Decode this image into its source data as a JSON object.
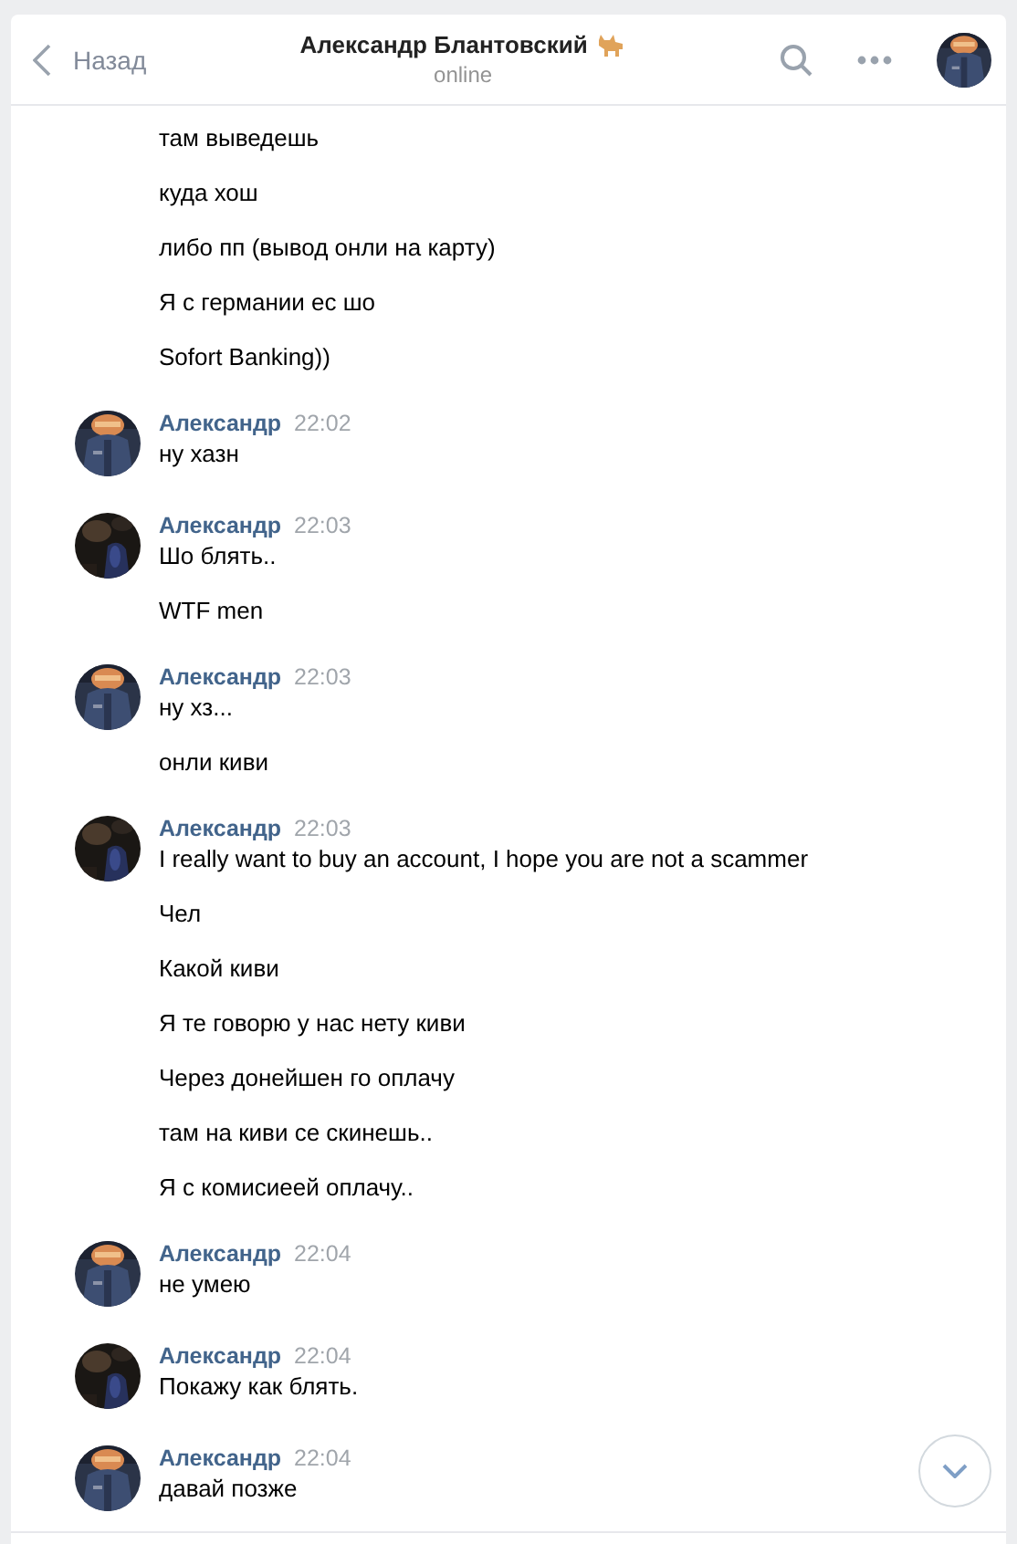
{
  "header": {
    "back_label": "Назад",
    "title": "Александр Блантовский",
    "status": "online"
  },
  "groups": [
    {
      "continued": true,
      "lines": [
        "там выведешь",
        "куда хош",
        "либо пп (вывод онли на карту)",
        "Я с германии ес шо",
        "Sofort Banking))"
      ]
    },
    {
      "continued": false,
      "author": "Александр",
      "time": "22:02",
      "lines": [
        "ну хазн"
      ]
    },
    {
      "continued": false,
      "author": "Александр",
      "time": "22:03",
      "lines": [
        "Шо блять..",
        "WTF men"
      ]
    },
    {
      "continued": false,
      "author": "Александр",
      "time": "22:03",
      "lines": [
        "ну хз...",
        "онли киви"
      ]
    },
    {
      "continued": false,
      "author": "Александр",
      "time": "22:03",
      "lines": [
        "I really want to buy an account, I hope you are not a scammer",
        "Чел",
        "Какой киви",
        "Я те говорю у нас нету киви",
        "Через донейшен го оплачу",
        "там на киви се скинешь..",
        "Я с комисиеей оплачу.."
      ]
    },
    {
      "continued": false,
      "author": "Александр",
      "time": "22:04",
      "lines": [
        "не умею"
      ]
    },
    {
      "continued": false,
      "author": "Александр",
      "time": "22:04",
      "lines": [
        "Покажу как блять."
      ]
    },
    {
      "continued": false,
      "author": "Александр",
      "time": "22:04",
      "lines": [
        "давай позже"
      ]
    }
  ]
}
